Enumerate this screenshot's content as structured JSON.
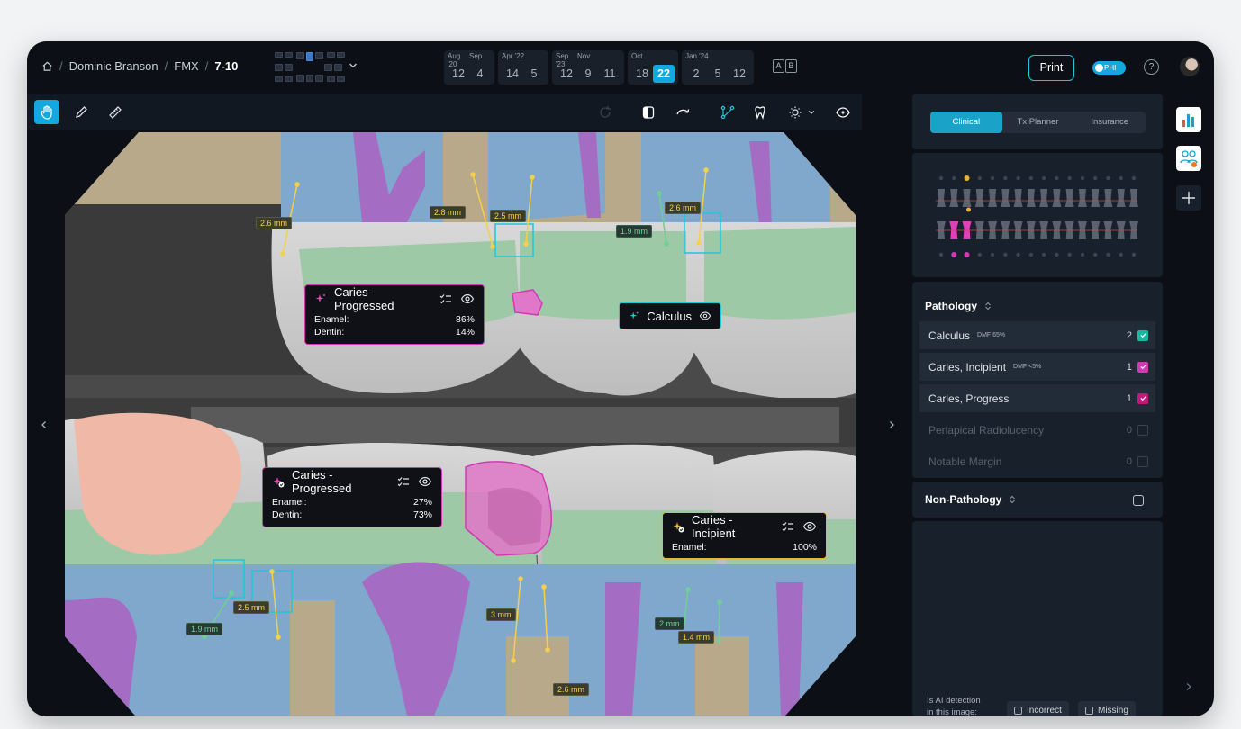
{
  "breadcrumb": {
    "patient": "Dominic Branson",
    "exam": "FMX",
    "series": "7-10",
    "sep": "/"
  },
  "timeline": [
    {
      "months": [
        [
          "Aug '20",
          1
        ],
        [
          "Sep",
          1
        ]
      ],
      "days": [
        "12",
        "4"
      ]
    },
    {
      "months": [
        [
          "Apr '22",
          2
        ]
      ],
      "days": [
        "14",
        "5"
      ]
    },
    {
      "months": [
        [
          "Sep '23",
          1
        ],
        [
          "Nov",
          2
        ]
      ],
      "days": [
        "12",
        "9",
        "11"
      ]
    },
    {
      "months": [
        [
          "Oct",
          2
        ]
      ],
      "days": [
        "18",
        "22"
      ],
      "active_index": 1
    },
    {
      "months": [
        [
          "Jan '24",
          3
        ]
      ],
      "days": [
        "2",
        "5",
        "12"
      ]
    }
  ],
  "ab": [
    "A",
    "B"
  ],
  "header": {
    "print": "Print",
    "phi": "PHI",
    "help": "?"
  },
  "tabs": [
    "Clinical",
    "Tx Planner",
    "Insurance"
  ],
  "tooth_chart": {
    "top_numbers": 16,
    "bottom_numbers": 16
  },
  "pathology": {
    "title": "Pathology",
    "items": [
      {
        "name": "Calculus",
        "dmf": "DMF 65%",
        "count": "2",
        "color": "#18b7a0",
        "checked": true
      },
      {
        "name": "Caries, Incipient",
        "dmf": "DMF <5%",
        "count": "1",
        "color": "#d23ab4",
        "checked": true
      },
      {
        "name": "Caries, Progress",
        "dmf": "",
        "count": "1",
        "color": "#c2187a",
        "checked": true
      },
      {
        "name": "Periapical Radiolucency",
        "dmf": "",
        "count": "0",
        "color": "",
        "checked": false
      },
      {
        "name": "Notable Margin",
        "dmf": "",
        "count": "0",
        "color": "",
        "checked": false
      }
    ]
  },
  "non_pathology": {
    "title": "Non-Pathology"
  },
  "ai_feedback": {
    "question_line1": "Is AI detection",
    "question_line2": "in this image:",
    "incorrect": "Incorrect",
    "missing": "Missing"
  },
  "findings": {
    "f1": {
      "title": "Caries - Progressed",
      "rows": [
        [
          "Enamel:",
          "86%"
        ],
        [
          "Dentin:",
          "14%"
        ]
      ]
    },
    "f2": {
      "title": "Calculus"
    },
    "f3": {
      "title": "Caries - Progressed",
      "rows": [
        [
          "Enamel:",
          "27%"
        ],
        [
          "Dentin:",
          "73%"
        ]
      ]
    },
    "f4": {
      "title": "Caries - Incipient",
      "rows": [
        [
          "Enamel:",
          "100%"
        ]
      ]
    }
  },
  "measurements": {
    "m1": "2.6 mm",
    "m2": "2.8 mm",
    "m3": "2.5 mm",
    "m4": "1.9 mm",
    "m5": "2.6 mm",
    "m6": "2.5 mm",
    "m7": "1.9 mm",
    "m8": "3 mm",
    "m9": "2.6 mm",
    "m10": "2 mm",
    "m11": "1.4 mm"
  },
  "colors": {
    "accent": "#14a8e0",
    "calculus": "#1ec8d8",
    "caries": "#d23ab4",
    "incipient": "#e8b430"
  }
}
